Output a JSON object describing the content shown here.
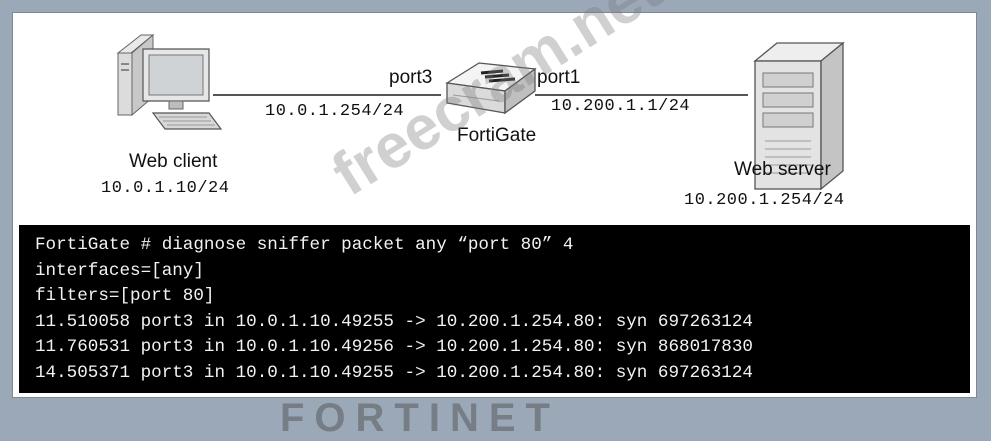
{
  "diagram": {
    "web_client": {
      "name": "Web client",
      "ip": "10.0.1.10/24"
    },
    "fortigate": {
      "name": "FortiGate",
      "port_left": "port3",
      "port_left_ip": "10.0.1.254/24",
      "port_right": "port1",
      "port_right_ip": "10.200.1.1/24"
    },
    "web_server": {
      "name": "Web server",
      "ip": "10.200.1.254/24"
    }
  },
  "terminal": {
    "lines": [
      "FortiGate # diagnose sniffer packet any “port 80” 4",
      "interfaces=[any]",
      "filters=[port 80]",
      "11.510058 port3 in 10.0.1.10.49255 -> 10.200.1.254.80: syn 697263124",
      "11.760531 port3 in 10.0.1.10.49256 -> 10.200.1.254.80: syn 868017830",
      "14.505371 port3 in 10.0.1.10.49255 -> 10.200.1.254.80: syn 697263124"
    ]
  },
  "watermark": {
    "text": "freecram.net"
  },
  "logo": {
    "text": "FORTINET"
  },
  "colors": {
    "background": "#9aa8b8",
    "terminal_bg": "#000000",
    "terminal_fg": "#f2f2f2"
  }
}
